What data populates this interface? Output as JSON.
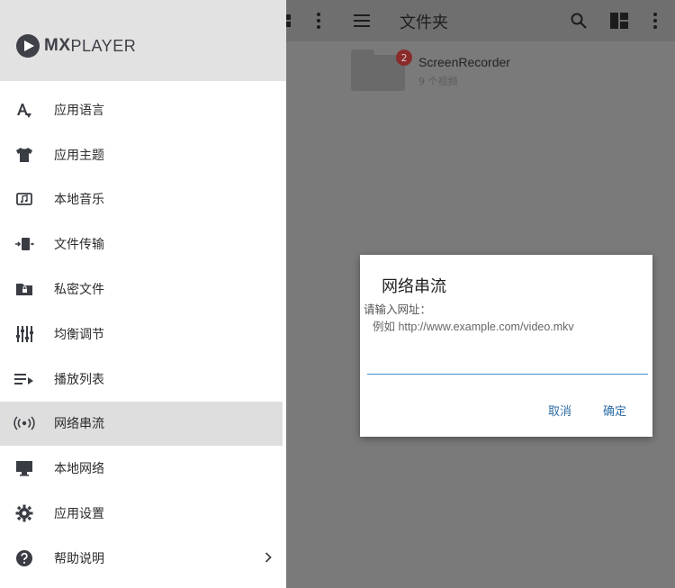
{
  "toolbar": {
    "title": "文件夹",
    "icons": [
      "more-vert-icon",
      "menu-icon",
      "search-icon",
      "grid-view-icon",
      "more-vert-icon"
    ]
  },
  "folder": {
    "name": "ScreenRecorder",
    "subtitle": "9 个视频",
    "badge": "2"
  },
  "drawer": {
    "logo": {
      "mx": "MX",
      "player": "PLAYER"
    },
    "items": [
      {
        "label": "应用语言",
        "icon": "language-icon"
      },
      {
        "label": "应用主题",
        "icon": "shirt-icon"
      },
      {
        "label": "本地音乐",
        "icon": "music-icon"
      },
      {
        "label": "文件传输",
        "icon": "transfer-icon"
      },
      {
        "label": "私密文件",
        "icon": "private-folder-icon"
      },
      {
        "label": "均衡调节",
        "icon": "equalizer-icon"
      },
      {
        "label": "播放列表",
        "icon": "playlist-icon"
      },
      {
        "label": "网络串流",
        "icon": "stream-icon"
      },
      {
        "label": "本地网络",
        "icon": "monitor-icon"
      },
      {
        "label": "应用设置",
        "icon": "gear-icon"
      },
      {
        "label": "帮助说明",
        "icon": "help-icon"
      }
    ],
    "active_index": 7
  },
  "dialog": {
    "title": "网络串流",
    "prompt": "请输入网址：",
    "example": "例如 http://www.example.com/video.mkv",
    "input_value": "",
    "cancel_label": "取消",
    "confirm_label": "确定"
  },
  "colors": {
    "accent": "#2e6da4",
    "drawer_header": "#e2e2e2",
    "active_row": "#dedede"
  }
}
